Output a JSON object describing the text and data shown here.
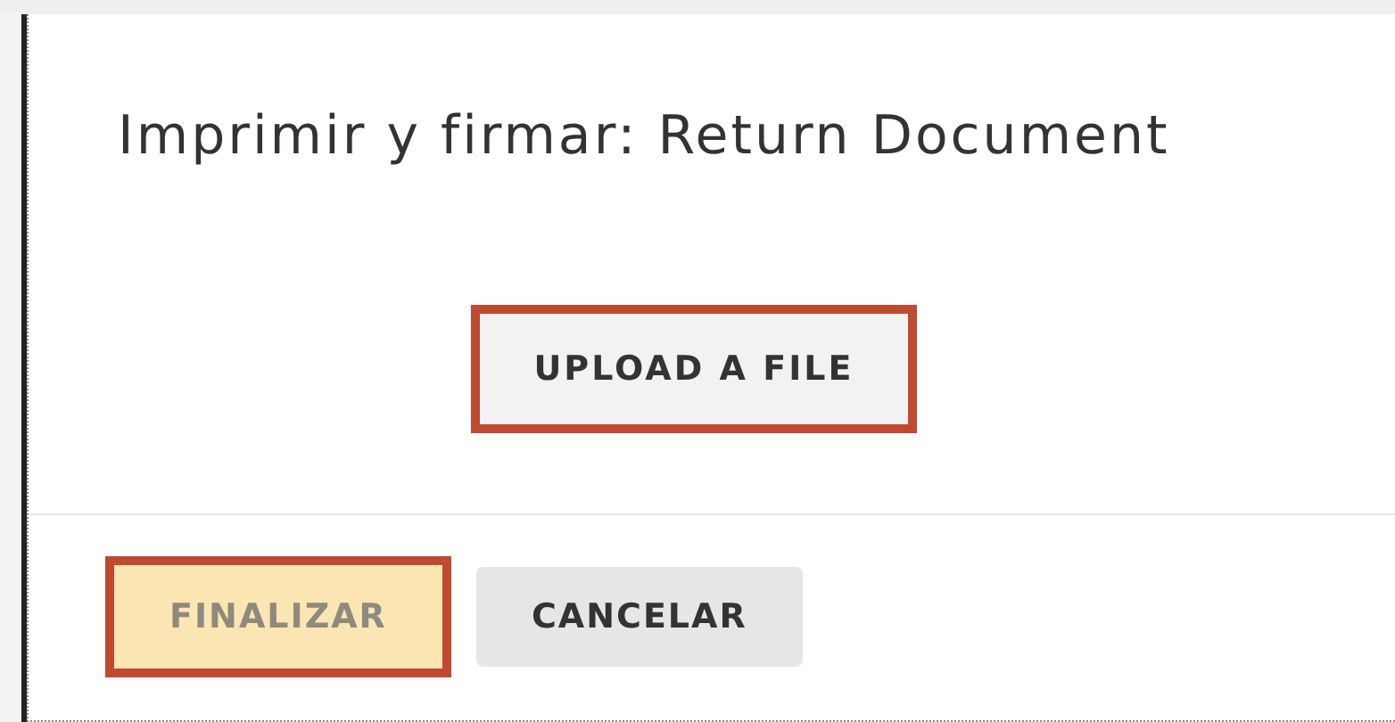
{
  "dialog": {
    "title": "Imprimir y firmar: Return Document"
  },
  "upload_button": {
    "label": "UPLOAD A FILE",
    "highlighted": true
  },
  "footer_buttons": [
    {
      "label": "FINALIZAR",
      "kind": "primary",
      "disabled": true,
      "highlighted": true
    },
    {
      "label": "CANCELAR",
      "kind": "secondary",
      "disabled": false,
      "highlighted": false
    }
  ]
}
